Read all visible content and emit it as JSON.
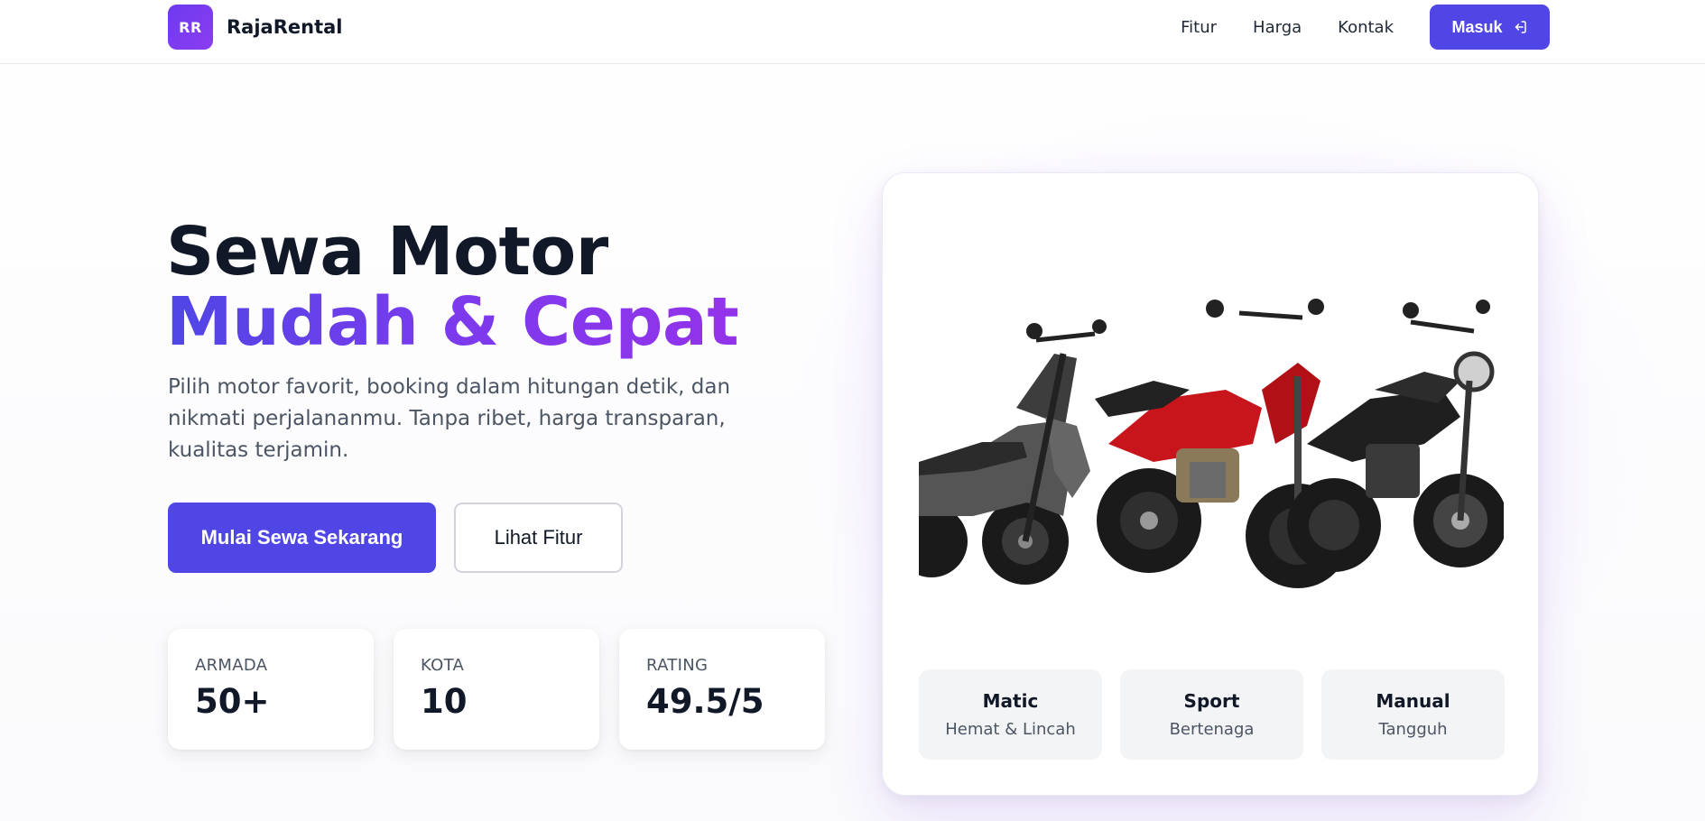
{
  "nav": {
    "logo_initials": "RR",
    "brand": "RajaRental",
    "links": [
      "Fitur",
      "Harga",
      "Kontak"
    ],
    "login_label": "Masuk",
    "login_icon": "login-arrow-icon"
  },
  "hero": {
    "title_plain": "Sewa Motor ",
    "title_accent": "Mudah & Cepat",
    "subtitle": "Pilih motor favorit, booking dalam hitungan detik, dan nikmati perjalananmu. Tanpa ribet, harga transparan, kualitas terjamin.",
    "primary_cta": "Mulai Sewa Sekarang",
    "secondary_cta": "Lihat Fitur",
    "stats": [
      {
        "label": "ARMADA",
        "value": "50+"
      },
      {
        "label": "KOTA",
        "value": "10"
      },
      {
        "label": "RATING",
        "value": "49.5/5"
      }
    ]
  },
  "showcase": {
    "categories": [
      {
        "name": "Matic",
        "desc": "Hemat & Lincah"
      },
      {
        "name": "Sport",
        "desc": "Bertenaga"
      },
      {
        "name": "Manual",
        "desc": "Tangguh"
      }
    ]
  },
  "colors": {
    "accent": "#4f46e5",
    "accent_purple": "#7c3aed",
    "text": "#111827",
    "muted": "#4b5563"
  }
}
